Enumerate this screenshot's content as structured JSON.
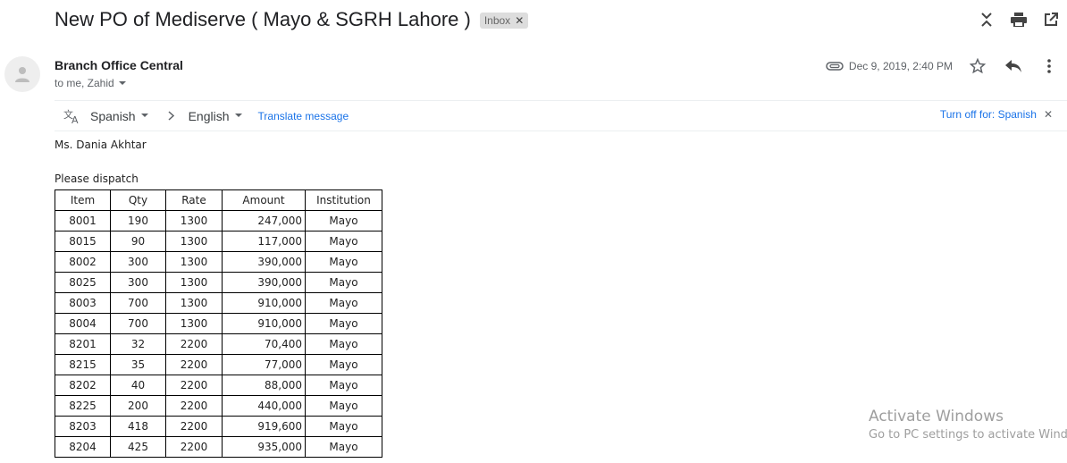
{
  "email": {
    "subject": "New PO of Mediserve ( Mayo & SGRH Lahore )",
    "label": "Inbox",
    "sender": "Branch Office Central",
    "recipients": "to me, Zahid",
    "date": "Dec 9, 2019, 2:40 PM"
  },
  "translate": {
    "from_lang": "Spanish",
    "to_lang": "English",
    "translate_link": "Translate message",
    "turn_off": "Turn off for: Spanish"
  },
  "body": {
    "greeting": "Ms. Dania Akhtar",
    "instruction": "Please dispatch"
  },
  "table": {
    "headers": [
      "Item",
      "Qty",
      "Rate",
      "Amount",
      "Institution"
    ],
    "rows": [
      [
        "8001",
        "190",
        "1300",
        "247,000",
        "Mayo"
      ],
      [
        "8015",
        "90",
        "1300",
        "117,000",
        "Mayo"
      ],
      [
        "8002",
        "300",
        "1300",
        "390,000",
        "Mayo"
      ],
      [
        "8025",
        "300",
        "1300",
        "390,000",
        "Mayo"
      ],
      [
        "8003",
        "700",
        "1300",
        "910,000",
        "Mayo"
      ],
      [
        "8004",
        "700",
        "1300",
        "910,000",
        "Mayo"
      ],
      [
        "8201",
        "32",
        "2200",
        "70,400",
        "Mayo"
      ],
      [
        "8215",
        "35",
        "2200",
        "77,000",
        "Mayo"
      ],
      [
        "8202",
        "40",
        "2200",
        "88,000",
        "Mayo"
      ],
      [
        "8225",
        "200",
        "2200",
        "440,000",
        "Mayo"
      ],
      [
        "8203",
        "418",
        "2200",
        "919,600",
        "Mayo"
      ],
      [
        "8204",
        "425",
        "2200",
        "935,000",
        "Mayo"
      ]
    ]
  },
  "watermark": {
    "line1": "Activate Windows",
    "line2": "Go to PC settings to activate Windows."
  }
}
